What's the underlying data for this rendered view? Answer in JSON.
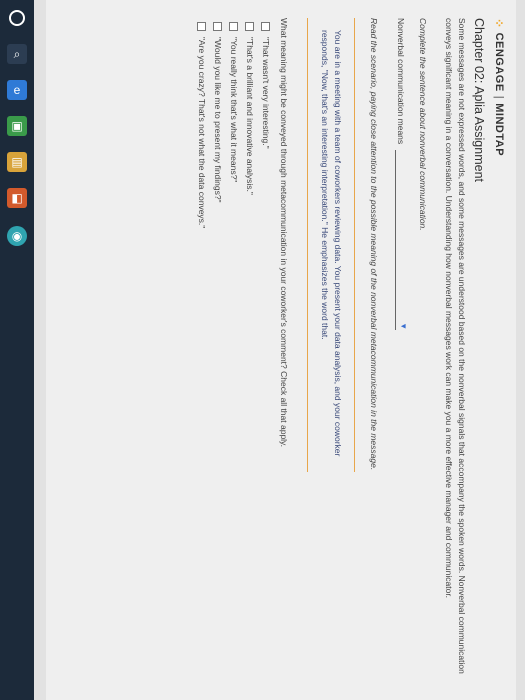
{
  "brand": {
    "logo_mark": "⁘",
    "name_left": "CENGAGE",
    "separator": "|",
    "name_right": "MINDTAP"
  },
  "chapter_title": "Chapter 02: Aplia Assignment",
  "intro": "Some messages are not expressed words, and some messages are understood based on the nonverbal signals that accompany the spoken words. Nonverbal communication conveys significant meaning in a conversation. Understanding how nonverbal messages work can make you a more effective manager and communicator.",
  "complete_instruction": "Complete the sentence about nonverbal communication.",
  "sentence_prompt": "Nonverbal communication means",
  "dropdown": {
    "value": "",
    "caret": "▼"
  },
  "scenario_instruction": "Read the scenario, paying close attention to the possible meaning of the nonverbal metacommunication in the message.",
  "scenario_text": "You are in a meeting with a team of coworkers reviewing data. You present your data analysis, and your coworker responds, \"Now, that's an interesting interpretation.\" He emphasizes the word that.",
  "question": "What meaning might be conveyed through metacommunication in your coworker's comment? Check all that apply.",
  "options": [
    "\"That wasn't very interesting.\"",
    "\"That's a brilliant and innovative analysis.\"",
    "\"You really think that's what it means?\"",
    "\"Would you like me to present my findings?\"",
    "\"Are you crazy? That's not what the data conveys.\""
  ],
  "taskbar": {
    "icons": [
      "start-icon",
      "search-icon",
      "edge-icon",
      "store-icon",
      "folder-icon",
      "office-icon",
      "chrome-icon"
    ]
  }
}
